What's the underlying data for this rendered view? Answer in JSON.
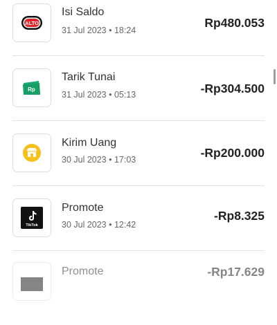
{
  "transactions": [
    {
      "title": "Isi Saldo",
      "time": "31 Jul 2023 • 18:24",
      "amount": "Rp480.053",
      "icon": "alto-icon",
      "icon_text": "ALTO"
    },
    {
      "title": "Tarik Tunai",
      "time": "31 Jul 2023 • 05:13",
      "amount": "-Rp304.500",
      "icon": "cash-withdraw-icon",
      "icon_text": "Rp"
    },
    {
      "title": "Kirim Uang",
      "time": "30 Jul 2023 • 17:03",
      "amount": "-Rp200.000",
      "icon": "store-icon"
    },
    {
      "title": "Promote",
      "time": "30 Jul 2023 • 12:42",
      "amount": "-Rp8.325",
      "icon": "tiktok-icon",
      "icon_text": "TikTok"
    },
    {
      "title": "Promote",
      "time": "",
      "amount": "-Rp17.629",
      "icon": "card-icon"
    }
  ],
  "colors": {
    "green": "#1aaa6e",
    "yellow": "#f5c11a",
    "black": "#111111",
    "red": "#e5232b"
  }
}
